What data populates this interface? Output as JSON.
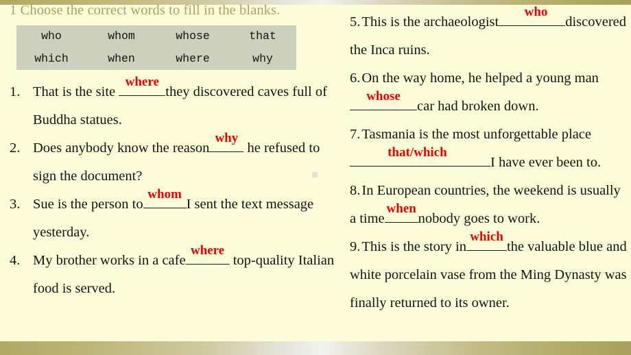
{
  "slide": {
    "title": "1 Choose the correct words to fill in the blanks.",
    "background_color": "#fcfcd8",
    "title_color": "#a9a163",
    "answer_color": "#ee0000",
    "wordbank_background": "#ccd0bc",
    "bar_color": "#a8a05c"
  },
  "wordbank": {
    "rows": [
      [
        "who",
        "whom",
        "whose",
        "that"
      ],
      [
        "which",
        "when",
        "where",
        "why"
      ]
    ]
  },
  "questions_left": [
    {
      "number": "1.",
      "before": "That is the site ",
      "answer": "where",
      "after": "they discovered caves full of Buddha statues."
    },
    {
      "number": "2.",
      "before": "Does anybody know the reason",
      "answer": "why",
      "after": " he refused to sign the document?"
    },
    {
      "number": "3.",
      "before": "Sue is the person to",
      "answer": "whom",
      "after": "I sent the text message yesterday."
    },
    {
      "number": "4.",
      "before": "My brother works in a cafe",
      "answer": "where",
      "after": " top-quality Italian food is served."
    }
  ],
  "questions_right": [
    {
      "number": "5.",
      "before": "This is the archaeologist",
      "answer": "who",
      "after": "discovered the Inca ruins."
    },
    {
      "number": "6.",
      "before": "On the way home, he helped a young man ",
      "answer": "whose",
      "after": "car had broken down."
    },
    {
      "number": "7.",
      "before": "Tasmania is the most unforgettable place ",
      "answer": "that/which",
      "after": "I have ever been to."
    },
    {
      "number": "8.",
      "before": "In European countries, the weekend is usually a time",
      "answer": "when",
      "after": "nobody goes to work."
    },
    {
      "number": "9.",
      "before": "This is the story in",
      "answer": "which",
      "after": "the valuable blue and white porcelain vase from the Ming Dynasty was finally returned to its owner."
    }
  ]
}
